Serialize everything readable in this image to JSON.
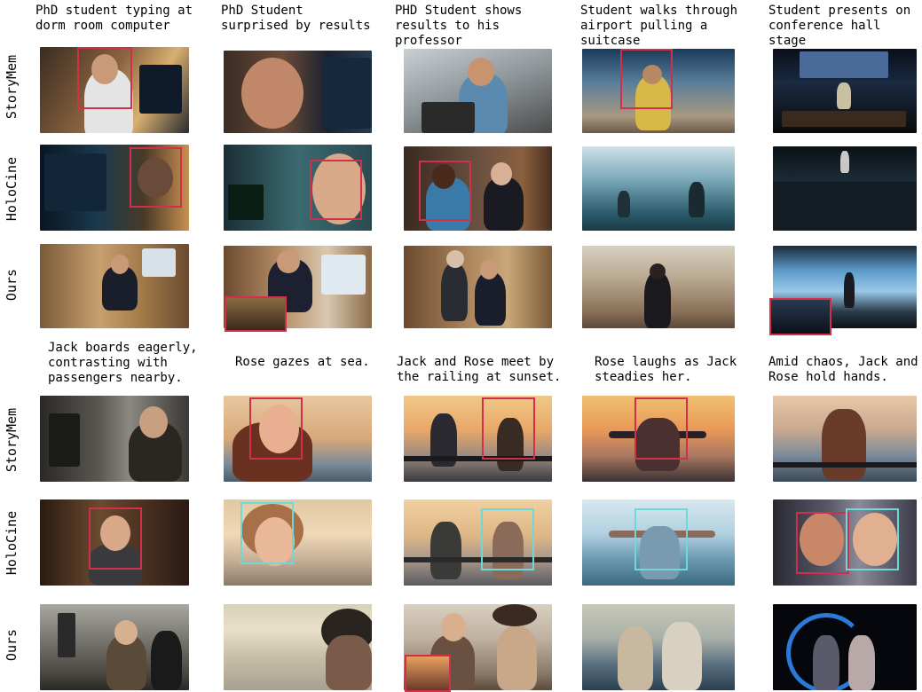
{
  "top_captions": [
    "PhD student typing at\ndorm room computer",
    "PhD Student\nsurprised by results",
    "PHD Student shows\nresults to his professor",
    "Student walks through\nairport pulling a suitcase",
    "Student presents on\nconference hall stage"
  ],
  "bottom_captions": [
    "Jack boards eagerly,\ncontrasting with\npassengers nearby.",
    "Rose gazes at sea.",
    "Jack and Rose meet by\nthe railing at sunset.",
    "Rose laughs as Jack\nsteadies her.",
    "Amid chaos, Jack and\nRose hold hands."
  ],
  "row_labels": [
    "StoryMem",
    "HoloCine",
    "Ours",
    "StoryMem",
    "HoloCine",
    "Ours"
  ],
  "box_colors": {
    "red": "#d0304a",
    "cyan": "#6fd8d8"
  }
}
